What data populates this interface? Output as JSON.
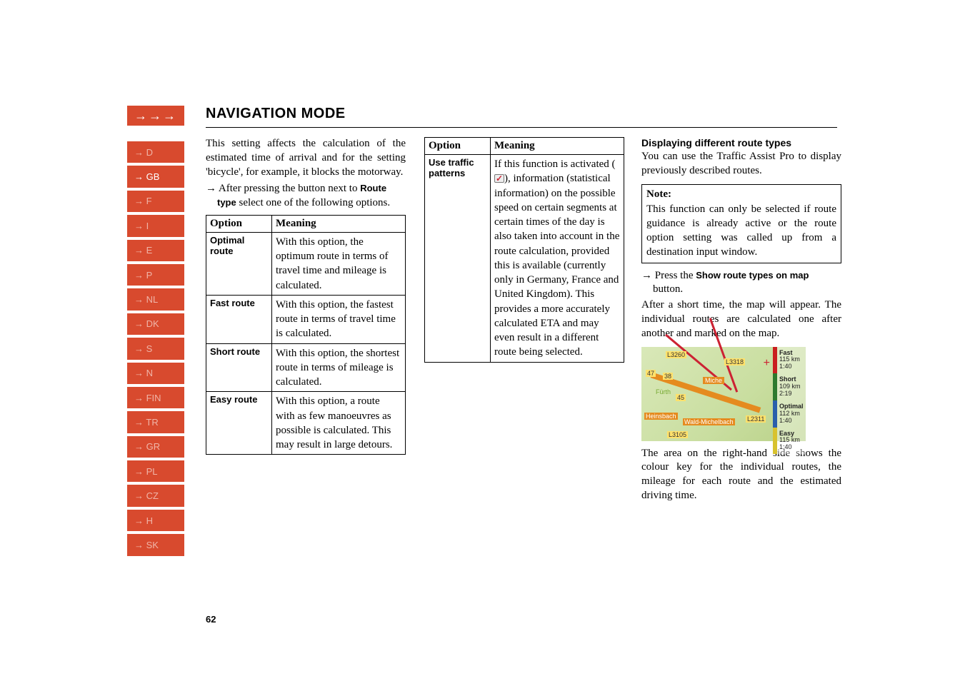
{
  "header": {
    "arrows": "→→→",
    "title": "NAVIGATION MODE"
  },
  "sidebar": {
    "items": [
      {
        "label": "→ D",
        "cls": "light"
      },
      {
        "label": "→ GB",
        "cls": "active"
      },
      {
        "label": "→ F",
        "cls": "light"
      },
      {
        "label": "→ I",
        "cls": "light"
      },
      {
        "label": "→ E",
        "cls": "light"
      },
      {
        "label": "→ P",
        "cls": "light"
      },
      {
        "label": "→ NL",
        "cls": "light"
      },
      {
        "label": "→ DK",
        "cls": "light"
      },
      {
        "label": "→ S",
        "cls": "light"
      },
      {
        "label": "→ N",
        "cls": "light"
      },
      {
        "label": "→ FIN",
        "cls": "light"
      },
      {
        "label": "→ TR",
        "cls": "light"
      },
      {
        "label": "→ GR",
        "cls": "light"
      },
      {
        "label": "→ PL",
        "cls": "light"
      },
      {
        "label": "→ CZ",
        "cls": "light"
      },
      {
        "label": "→ H",
        "cls": "light"
      },
      {
        "label": "→ SK",
        "cls": "light"
      }
    ]
  },
  "col1": {
    "para": "This setting affects the calculation of the estimated time of arrival and for the setting 'bicycle', for example, it blocks the motorway.",
    "instr_pre": "→ After pressing the button next to ",
    "instr_bold1": "Route type",
    "instr_post": " select one of the following options.",
    "table": {
      "h1": "Option",
      "h2": "Meaning",
      "rows": [
        {
          "opt": "Optimal route",
          "meaning": "With this option, the optimum route in terms of travel time and mileage is calculated."
        },
        {
          "opt": "Fast route",
          "meaning": "With this option, the fastest route in terms of travel time is calculated."
        },
        {
          "opt": "Short route",
          "meaning": "With this option, the shortest route in terms of mileage is calculated."
        },
        {
          "opt": "Easy route",
          "meaning": "With this option, a route with as few manoeuvres as possible is calculated. This may result in large detours."
        }
      ]
    }
  },
  "col2": {
    "table": {
      "h1": "Option",
      "h2": "Meaning",
      "rows": [
        {
          "opt": "Use traffic patterns",
          "meaning_pre": "If this function is activated (",
          "meaning_post": "), information (statistical information) on the possible speed on certain segments at certain times of the day is also taken into account in the route calculation, provided this is available (currently only in Germany, France and United Kingdom). This provides a more accurately calculated ETA and may even result in a different route being selected."
        }
      ]
    }
  },
  "col3": {
    "sec_heading": "Displaying different route types",
    "para1": "You can use the Traffic Assist Pro to display previously described routes.",
    "note_title": "Note:",
    "note_body": "This function can only be selected if route guidance is already active or the route option setting was called up from a destination input window.",
    "instr_pre": "→ Press the ",
    "instr_bold": "Show route types on map",
    "instr_post": " button.",
    "para2": "After a short time, the map will appear. The individual routes are calculated one after another and marked on the map.",
    "map": {
      "labels": [
        "L3260",
        "L3318",
        "47",
        "38",
        "Miche",
        "Fürth",
        "45",
        "Heinsbach",
        "Wald-Michelbach",
        "L2311",
        "L3105"
      ],
      "plus": "+",
      "legend": [
        {
          "name": "Fast",
          "dist": "115 km",
          "time": "1:40",
          "color": "#c91f1f"
        },
        {
          "name": "Short",
          "dist": "109 km",
          "time": "2:19",
          "color": "#2d7a2d"
        },
        {
          "name": "Optimal",
          "dist": "112 km",
          "time": "1:40",
          "color": "#2a5fab"
        },
        {
          "name": "Easy",
          "dist": "115 km",
          "time": "1:40",
          "color": "#d8c22e"
        }
      ]
    },
    "para3": "The area on the right-hand side shows the colour key for the individual routes, the mileage for each route and the estimated driving time."
  },
  "page": "62"
}
